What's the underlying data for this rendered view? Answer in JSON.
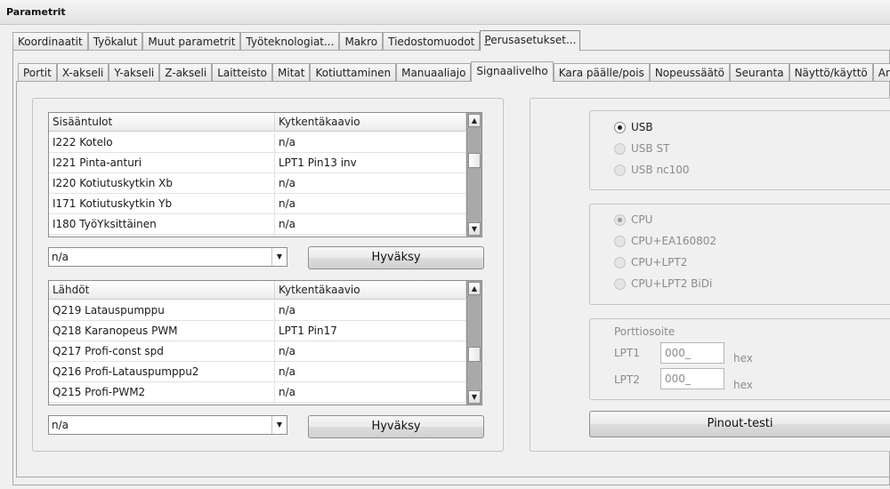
{
  "window": {
    "title": "Parametrit"
  },
  "main_tabs": [
    {
      "label": "Koordinaatit"
    },
    {
      "label": "Työkalut"
    },
    {
      "label": "Muut parametrit"
    },
    {
      "label": "Työteknologiat..."
    },
    {
      "label": "Makro"
    },
    {
      "label": "Tiedostomuodot"
    },
    {
      "label": "Perusasetukset...",
      "underline": "P",
      "rest": "erusasetukset..."
    }
  ],
  "sub_tabs": [
    {
      "label": "Portit"
    },
    {
      "label": "X-akseli"
    },
    {
      "label": "Y-akseli"
    },
    {
      "label": "Z-akseli"
    },
    {
      "label": "Laitteisto"
    },
    {
      "label": "Mitat"
    },
    {
      "label": "Kotiuttaminen"
    },
    {
      "label": "Manuaaliajo"
    },
    {
      "label": "Signaalivelho"
    },
    {
      "label": "Kara päälle/pois"
    },
    {
      "label": "Nopeussäätö"
    },
    {
      "label": "Seuranta"
    },
    {
      "label": "Näyttö/käyttö"
    },
    {
      "label": "Anturi"
    }
  ],
  "inputs_table": {
    "headers": [
      "Sisääntulot",
      "Kytkentäkaavio"
    ],
    "rows": [
      [
        "I222 Kotelo",
        "n/a"
      ],
      [
        "I221 Pinta-anturi",
        "LPT1 Pin13 inv"
      ],
      [
        "I220 Kotiutuskytkin Xb",
        "n/a"
      ],
      [
        "I171 Kotiutuskytkin Yb",
        "n/a"
      ],
      [
        "I180 TyöYksittäinen",
        "n/a"
      ]
    ],
    "combo_value": "n/a",
    "accept_label": "Hyväksy"
  },
  "outputs_table": {
    "headers": [
      "Lähdöt",
      "Kytkentäkaavio"
    ],
    "rows": [
      [
        "Q219 Latauspumppu",
        "n/a"
      ],
      [
        "Q218 Karanopeus PWM",
        "LPT1 Pin17"
      ],
      [
        "Q217 Profi-const spd",
        "n/a"
      ],
      [
        "Q216 Profi-Latauspumppu2",
        "n/a"
      ],
      [
        "Q215 Profi-PWM2",
        "n/a"
      ]
    ],
    "combo_value": "n/a",
    "accept_label": "Hyväksy"
  },
  "interface_group": {
    "options": [
      {
        "label": "USB",
        "selected": true,
        "enabled": true
      },
      {
        "label": "USB ST",
        "selected": false,
        "enabled": false
      },
      {
        "label": "USB nc100",
        "selected": false,
        "enabled": false
      }
    ]
  },
  "cpu_group": {
    "options": [
      {
        "label": "CPU",
        "selected": true,
        "enabled": false
      },
      {
        "label": "CPU+EA160802",
        "selected": false,
        "enabled": false
      },
      {
        "label": "CPU+LPT2",
        "selected": false,
        "enabled": false
      },
      {
        "label": "CPU+LPT2 BiDi",
        "selected": false,
        "enabled": false
      }
    ]
  },
  "port_address": {
    "title": "Porttiosoite",
    "lpt1_label": "LPT1",
    "lpt1_value": "000_",
    "lpt2_label": "LPT2",
    "lpt2_value": "000_",
    "unit": "hex"
  },
  "pinout_button": {
    "label": "Pinout-testi"
  },
  "icons": {
    "scroll_up": "▲",
    "scroll_down": "▼",
    "combo_arrow": "▼"
  }
}
